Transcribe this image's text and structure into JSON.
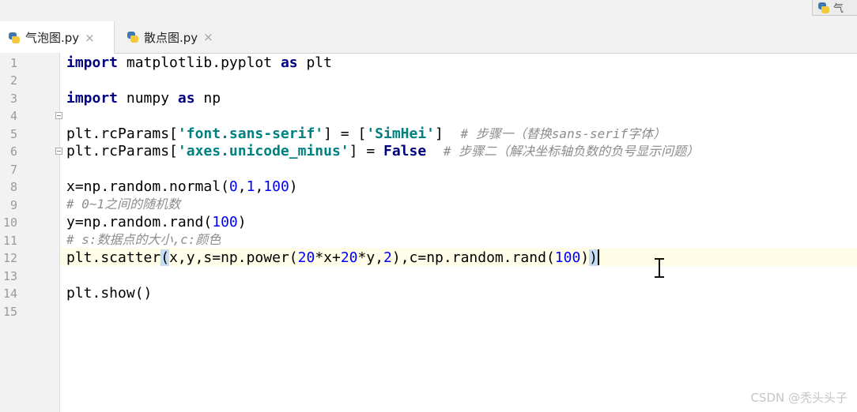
{
  "corner_tab_label": "气",
  "tabs": [
    {
      "label": "气泡图.py",
      "close": "×",
      "active": true
    },
    {
      "label": "散点图.py",
      "close": "×",
      "active": false
    }
  ],
  "line_numbers": [
    "1",
    "2",
    "3",
    "4",
    "5",
    "6",
    "7",
    "8",
    "9",
    "10",
    "11",
    "12",
    "13",
    "14",
    "15"
  ],
  "code": {
    "l1_kw": "import",
    "l1_rest": " matplotlib.pyplot ",
    "l1_as": "as",
    "l1_end": " plt",
    "l3_kw": "import",
    "l3_rest": " numpy ",
    "l3_as": "as",
    "l3_end": " np",
    "l5_a": "plt.rcParams[",
    "l5_s1": "'font.sans-serif'",
    "l5_b": "] = [",
    "l5_s2": "'SimHei'",
    "l5_c": "]  ",
    "l5_cm": "# 步骤一（替换sans-serif字体）",
    "l6_a": "plt.rcParams[",
    "l6_s1": "'axes.unicode_minus'",
    "l6_b": "] = ",
    "l6_kw": "False",
    "l6_c": "  ",
    "l6_cm": "# 步骤二（解决坐标轴负数的负号显示问题）",
    "l8_a": "x=np.random.normal(",
    "l8_n1": "0",
    "l8_c1": ",",
    "l8_n2": "1",
    "l8_c2": ",",
    "l8_n3": "100",
    "l8_e": ")",
    "l9_cm": "# 0~1之间的随机数",
    "l10_a": "y=np.random.rand(",
    "l10_n": "100",
    "l10_e": ")",
    "l11_cm": "# s:数据点的大小,c:颜色",
    "l12_a": "plt.scatter",
    "l12_p1": "(",
    "l12_b": "x,y,s=np.power(",
    "l12_n1": "20",
    "l12_c": "*x+",
    "l12_n2": "20",
    "l12_d": "*y,",
    "l12_n3": "2",
    "l12_e": "),c=np.random.rand(",
    "l12_n4": "100",
    "l12_f": ")",
    "l12_p2": ")",
    "l14": "plt.show()"
  },
  "watermark": "CSDN @秃头头子"
}
